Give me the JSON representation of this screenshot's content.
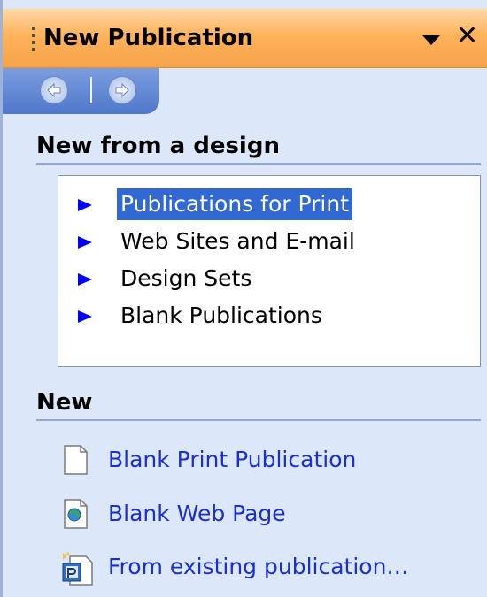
{
  "pane": {
    "title": "New Publication",
    "accent_color": "#ffb35a",
    "icons": {
      "grip": "grip-icon",
      "menu": "dropdown-arrow-icon",
      "close": "close-icon",
      "back": "back-arrow-icon",
      "forward": "forward-arrow-icon"
    }
  },
  "design_section": {
    "title": "New from a design",
    "items": [
      {
        "label": "Publications for Print",
        "selected": true
      },
      {
        "label": "Web Sites and E-mail",
        "selected": false
      },
      {
        "label": "Design Sets",
        "selected": false
      },
      {
        "label": "Blank Publications",
        "selected": false
      }
    ]
  },
  "new_section": {
    "title": "New",
    "links": [
      {
        "label": "Blank Print Publication",
        "icon": "blank-page-icon"
      },
      {
        "label": "Blank Web Page",
        "icon": "web-page-icon"
      },
      {
        "label": "From existing publication…",
        "icon": "publisher-file-icon"
      }
    ]
  }
}
